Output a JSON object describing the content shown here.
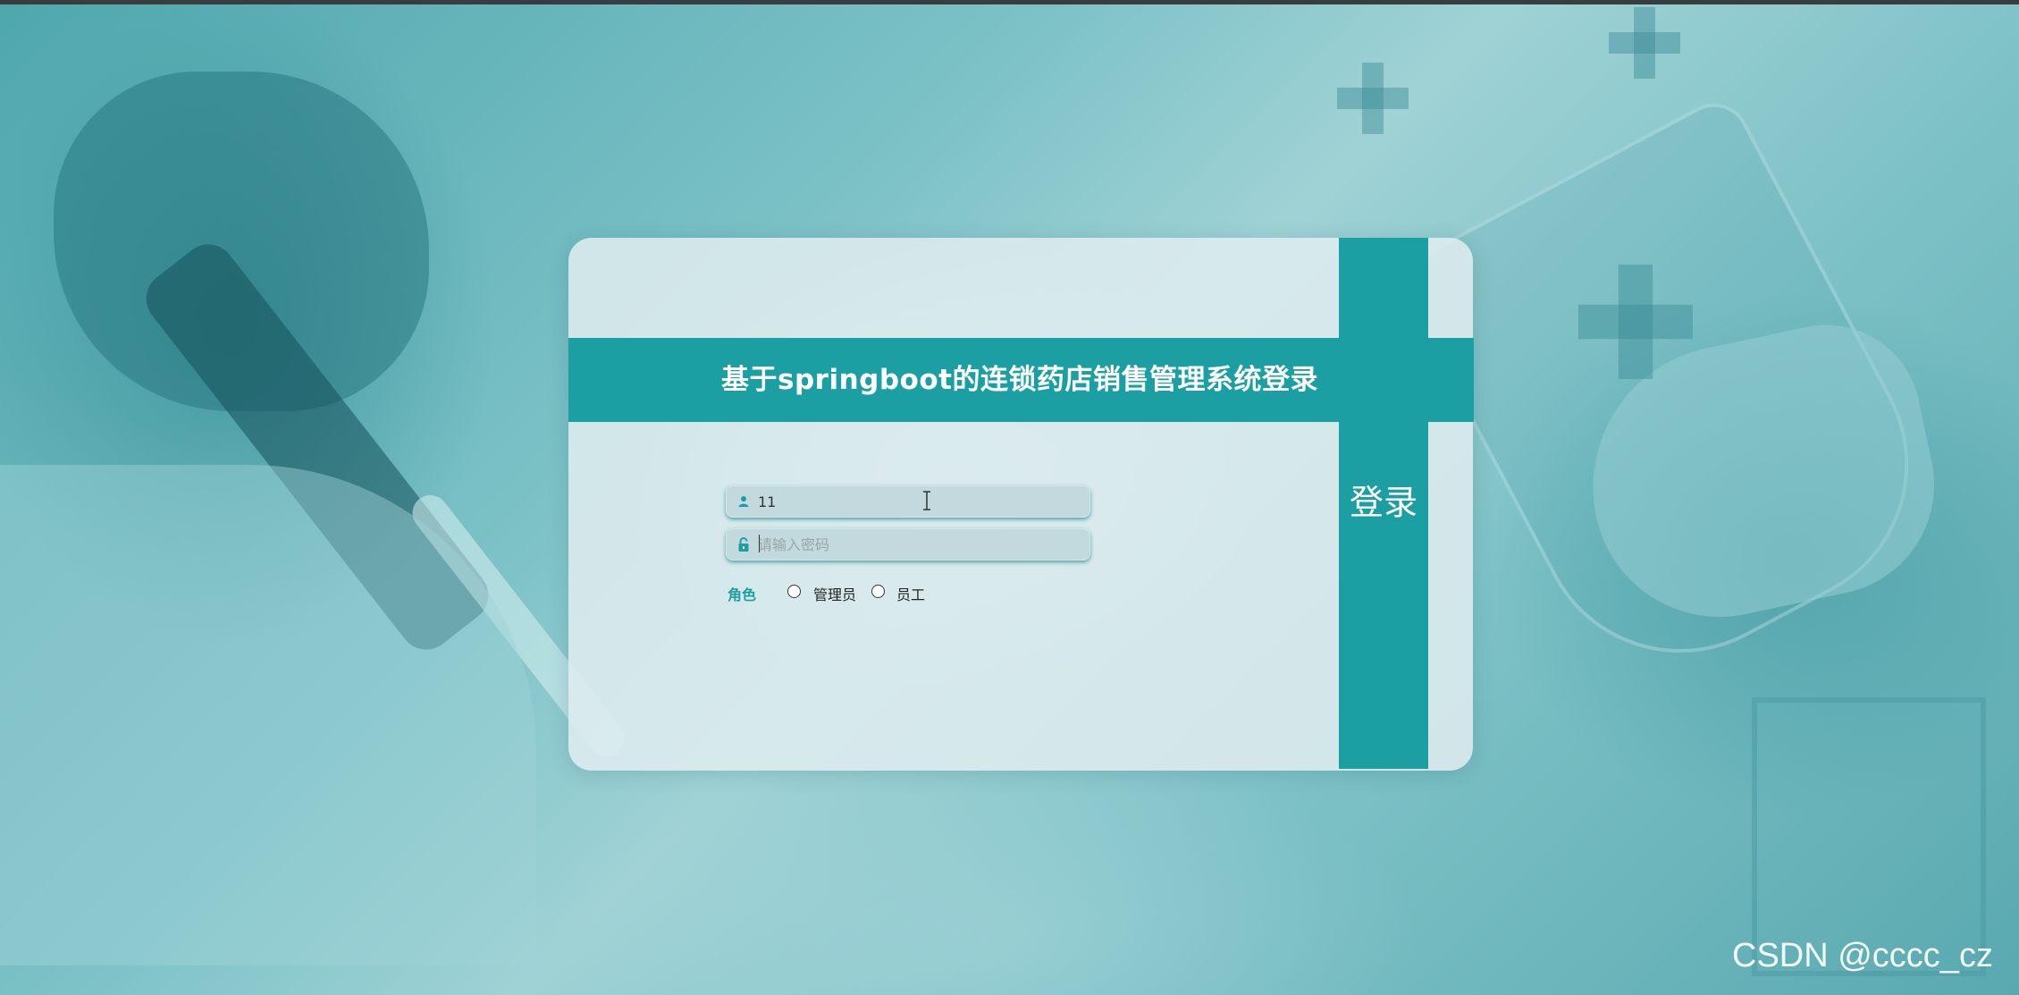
{
  "page": {
    "title": "基于springboot的连锁药店销售管理系统登录",
    "login_button": "登录"
  },
  "form": {
    "username": {
      "value": "11",
      "icon": "user-icon"
    },
    "password": {
      "value": "",
      "placeholder": "请输入密码",
      "icon": "lock-icon"
    },
    "role": {
      "label": "角色",
      "options": [
        "管理员",
        "员工"
      ]
    }
  },
  "watermark": "CSDN @cccc_cz",
  "colors": {
    "accent": "#1b9fa3",
    "card": "#dfecee",
    "background": "#7cc2c7"
  }
}
